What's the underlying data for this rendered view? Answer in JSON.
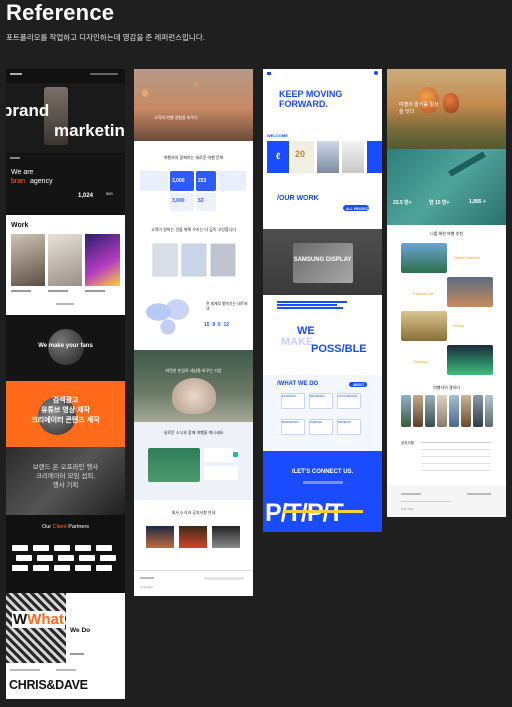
{
  "header": {
    "title": "Reference",
    "subtitle": "포트폴리오를 작업하고 디자인하는데 영감을 준 레퍼런스입니다."
  },
  "card1": {
    "brand": "brand",
    "marketing": "marketing",
    "we_are": "We are",
    "bran_ma": "bran",
    "agency": "agency",
    "work": "Work",
    "make_fans": "We make your fans",
    "korean_lines": [
      "검색광고",
      "유튜브 영상 제작",
      "크리에이터 콘텐츠 제작"
    ],
    "gray_lines": [
      "브랜드 온·오프라인 행사",
      "크리에이터 모임 섭외,",
      "행사 기획"
    ],
    "our_client": "Our",
    "client_word": "Client",
    "partners": "Partners",
    "what": "What",
    "we_do": "We Do",
    "chris_dave": "CHRIS&DAVE",
    "stat_num": "1,024",
    "stat_num2": "500"
  },
  "card2": {
    "hero_line": "고객의 여행 경험을 바꾸다",
    "stats_title": "여행자와 함께하는 새로운 여행 문화",
    "stat1": "3,000",
    "stat2": "253",
    "stat3": "3,000",
    "stat4": "53",
    "section2": "고객이 원하는 것을 위해 우리는 더 깊이 고민합니다",
    "map_title": "전 세계로 뻗어가는 네트워크",
    "map_nums": [
      "15",
      "8",
      "5",
      "12"
    ],
    "hands_text": "따뜻한 손길로 세상을 바꾸는 기업",
    "news_title": "새로운 소식과 함께 여행을 떠나세요",
    "bottom_title": "회사 소식과 공지사항 안내",
    "footer": "Copyright"
  },
  "card3": {
    "hero": "KEEP MOVING FORWARD.",
    "welcome": "WELCOME",
    "our_work": "/OUR WORK",
    "all_project": "ALL PROJECT",
    "samsung": "SAMSUNG DISPLAY",
    "we": "WE",
    "make": "MAKE",
    "possible": "POSS/BLE",
    "what_we_do": "/WHAT WE DO",
    "about": "ABOUT",
    "services": [
      "PLANNING",
      "BRANDING",
      "UX/UI DESIGN",
      "MARKETING",
      "PUBLISH",
      "DEVELOP"
    ],
    "connect": "/LET'S CONNECT US.",
    "big_text": "P/T/P/T",
    "welcome_num": "20"
  },
  "card4": {
    "hero_text": "여행의 즐거움 일상을 잇다",
    "stats": [
      "23.5 만+",
      "연 15 만+",
      "1,885 +"
    ],
    "list_title": "나를 위한 여행 추천",
    "items": [
      {
        "label": "Global Fashion"
      },
      {
        "label": "Fashion Art"
      },
      {
        "label": "Sunny"
      },
      {
        "label": "Glowing"
      }
    ],
    "gallery_title": "여행자의 갤러리",
    "notice_title": "공지사항",
    "footer_label": "FOOTER"
  },
  "colors": {
    "bg": "#1f1f1f",
    "orange": "#ff6b1a",
    "blue": "#1b4bff",
    "dark_green": "#3e5a4a"
  }
}
